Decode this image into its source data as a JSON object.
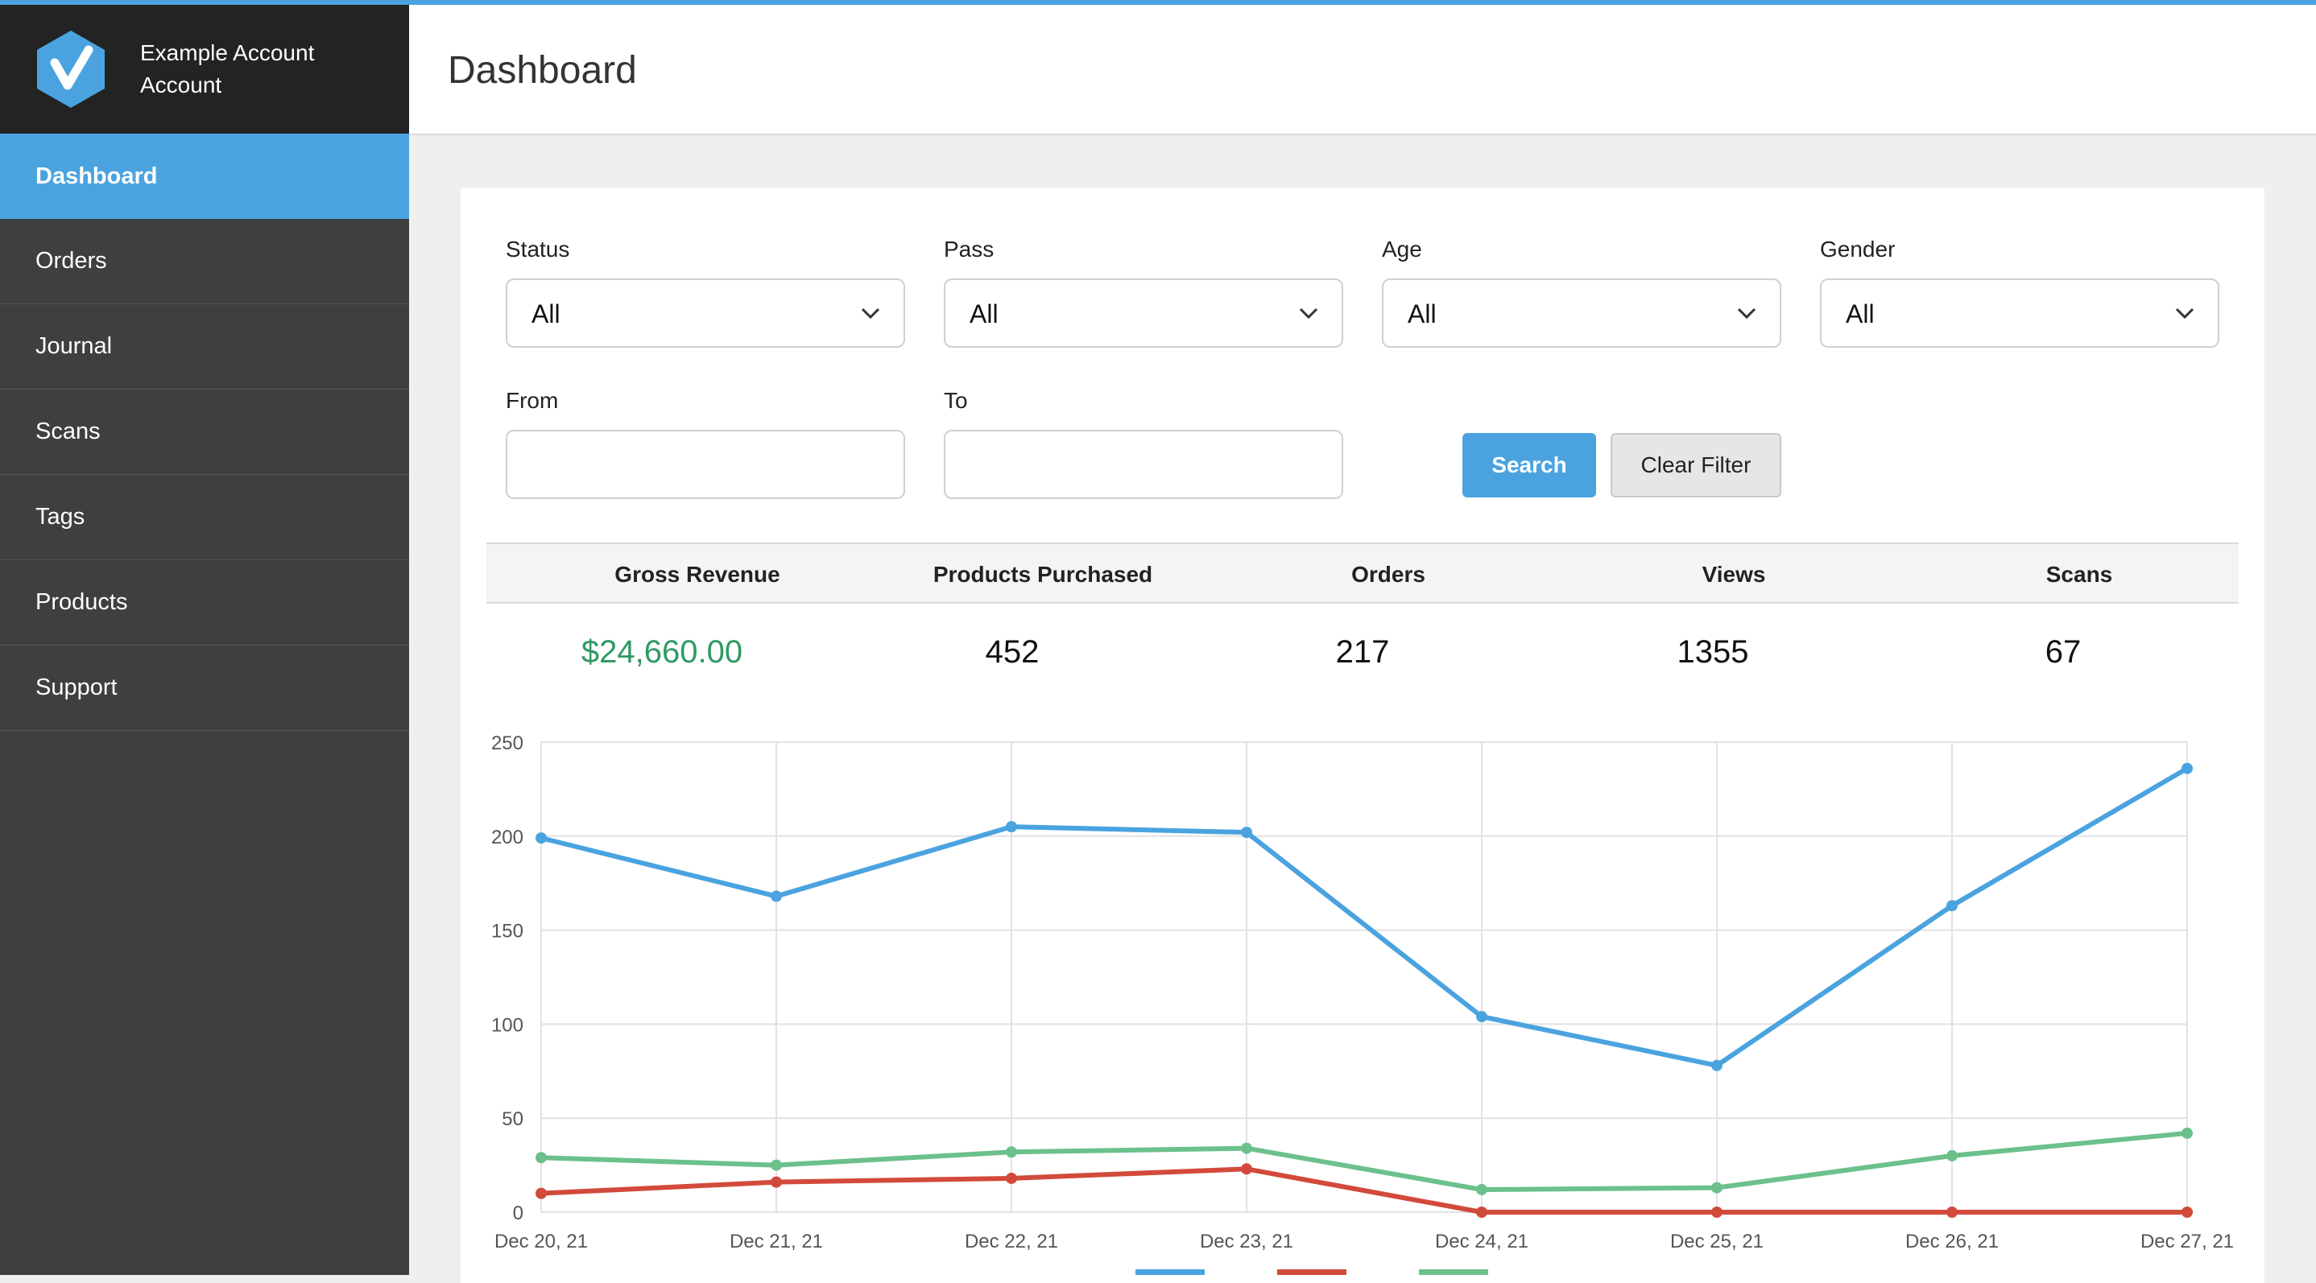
{
  "account": {
    "name": "Example Account",
    "role": "Account"
  },
  "sidebar": {
    "items": [
      {
        "label": "Dashboard",
        "active": true
      },
      {
        "label": "Orders"
      },
      {
        "label": "Journal"
      },
      {
        "label": "Scans"
      },
      {
        "label": "Tags"
      },
      {
        "label": "Products"
      },
      {
        "label": "Support"
      }
    ]
  },
  "header": {
    "title": "Dashboard"
  },
  "filters": {
    "status": {
      "label": "Status",
      "value": "All"
    },
    "pass": {
      "label": "Pass",
      "value": "All"
    },
    "age": {
      "label": "Age",
      "value": "All"
    },
    "gender": {
      "label": "Gender",
      "value": "All"
    },
    "from": {
      "label": "From",
      "value": ""
    },
    "to": {
      "label": "To",
      "value": ""
    },
    "search_label": "Search",
    "clear_label": "Clear Filter"
  },
  "stats": {
    "gross_revenue": {
      "label": "Gross Revenue",
      "value": "$24,660.00"
    },
    "products_purchased": {
      "label": "Products Purchased",
      "value": "452"
    },
    "orders": {
      "label": "Orders",
      "value": "217"
    },
    "views": {
      "label": "Views",
      "value": "1355"
    },
    "scans": {
      "label": "Scans",
      "value": "67"
    }
  },
  "colors": {
    "accent": "#4aa3df",
    "money": "#2e9a62",
    "series_blue": "#4aa3df",
    "series_red": "#d24a3b",
    "series_green": "#6cc08c"
  },
  "chart_data": {
    "type": "line",
    "categories": [
      "Dec 20, 21",
      "Dec 21, 21",
      "Dec 22, 21",
      "Dec 23, 21",
      "Dec 24, 21",
      "Dec 25, 21",
      "Dec 26, 21",
      "Dec 27, 21"
    ],
    "ylim": [
      0,
      250
    ],
    "yticks": [
      0,
      50,
      100,
      150,
      200,
      250
    ],
    "grid": true,
    "legend": "bottom",
    "series": [
      {
        "color": "#4aa3df",
        "values": [
          199,
          168,
          205,
          202,
          104,
          78,
          163,
          236
        ]
      },
      {
        "color": "#d24a3b",
        "values": [
          10,
          16,
          18,
          23,
          0,
          0,
          0,
          0
        ]
      },
      {
        "color": "#6cc08c",
        "values": [
          29,
          25,
          32,
          34,
          12,
          13,
          30,
          42
        ]
      }
    ]
  }
}
